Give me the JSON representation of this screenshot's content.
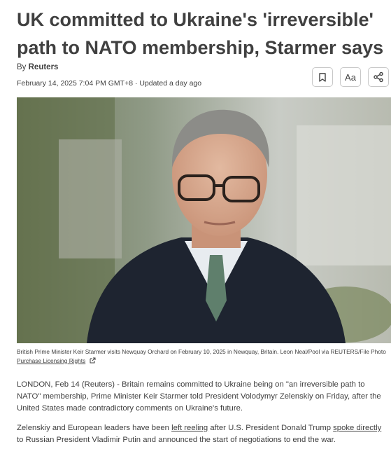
{
  "article": {
    "headline": "UK committed to Ukraine's 'irreversible' path to NATO membership, Starmer says",
    "byline_prefix": "By",
    "byline_author": "Reuters",
    "date": "February 14, 2025 7:04 PM GMT+8 · Updated a day ago"
  },
  "tools": {
    "bookmark_icon": "bookmark-icon",
    "text_size_label": "Aa",
    "share_icon": "share-icon"
  },
  "photo": {
    "caption": "British Prime Minister Keir Starmer visits Newquay Orchard on February 10, 2025 in Newquay, Britain. Leon Neal/Pool via REUTERS/File Photo",
    "licensing_link": "Purchase Licensing Rights"
  },
  "body": {
    "p1": "LONDON, Feb 14 (Reuters) - Britain remains committed to Ukraine being on \"an irreversible path to NATO\" membership, Prime Minister Keir Starmer told President Volodymyr Zelenskiy on Friday, after the United States made contradictory comments on Ukraine's future.",
    "p2_a": "Zelenskiy and European leaders have been ",
    "p2_link1": "left reeling",
    "p2_b": " after U.S. President Donald Trump ",
    "p2_link2": "spoke directly",
    "p2_c": " to Russian President Vladimir Putin and announced the start of negotiations to end the war."
  }
}
